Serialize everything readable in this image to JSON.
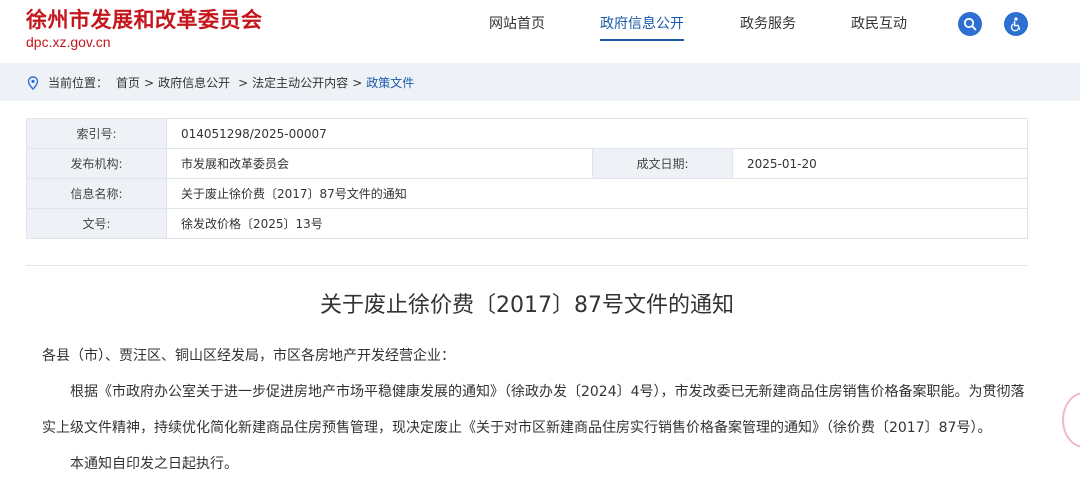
{
  "site": {
    "title": "徐州市发展和改革委员会",
    "domain": "dpc.xz.gov.cn"
  },
  "nav": {
    "items": [
      {
        "label": "网站首页",
        "active": false
      },
      {
        "label": "政府信息公开",
        "active": true
      },
      {
        "label": "政务服务",
        "active": false
      },
      {
        "label": "政民互动",
        "active": false
      }
    ],
    "search_icon": "search-icon",
    "accessibility_icon": "accessibility-icon",
    "accent": "#1a5aa8",
    "brand": "#c4161c"
  },
  "breadcrumb": {
    "prefix": "当前位置：",
    "items": [
      "首页",
      "政府信息公开",
      "法定主动公开内容",
      "政策文件"
    ]
  },
  "info": {
    "index_label": "索引号:",
    "index_value": "014051298/2025-00007",
    "publisher_label": "发布机构:",
    "publisher_value": "市发展和改革委员会",
    "date_label": "成文日期:",
    "date_value": "2025-01-20",
    "name_label": "信息名称:",
    "name_value": "关于废止徐价费〔2017〕87号文件的通知",
    "docno_label": "文号:",
    "docno_value": "徐发改价格〔2025〕13号"
  },
  "document": {
    "title": "关于废止徐价费〔2017〕87号文件的通知",
    "salutation": "各县（市）、贾汪区、铜山区经发局，市区各房地产开发经营企业：",
    "paragraph1": "根据《市政府办公室关于进一步促进房地产市场平稳健康发展的通知》（徐政办发〔2024〕4号），市发改委已无新建商品住房销售价格备案职能。为贯彻落实上级文件精神，持续优化简化新建商品住房预售管理，现决定废止《关于对市区新建商品住房实行销售价格备案管理的通知》（徐价费〔2017〕87号）。",
    "paragraph2": "本通知自印发之日起执行。"
  }
}
